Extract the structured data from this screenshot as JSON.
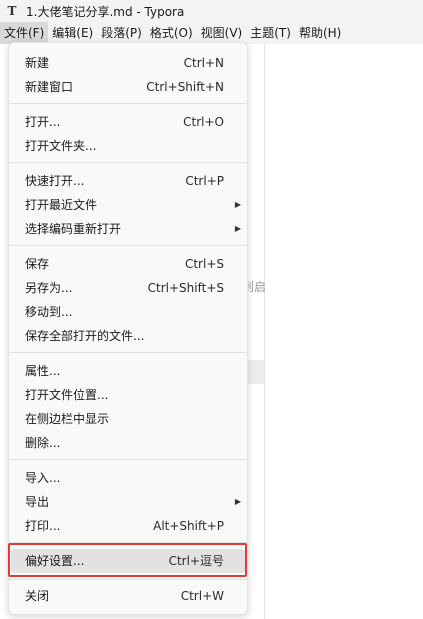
{
  "window": {
    "app_icon": "T",
    "title": "1.大佬笔记分享.md - Typora"
  },
  "menubar": [
    {
      "label": "文件(F)",
      "active": true
    },
    {
      "label": "编辑(E)"
    },
    {
      "label": "段落(P)"
    },
    {
      "label": "格式(O)"
    },
    {
      "label": "视图(V)"
    },
    {
      "label": "主题(T)"
    },
    {
      "label": "帮助(H)"
    }
  ],
  "background": {
    "partial_text": "到启"
  },
  "file_menu": {
    "items": [
      {
        "label": "新建",
        "shortcut": "Ctrl+N"
      },
      {
        "label": "新建窗口",
        "shortcut": "Ctrl+Shift+N"
      },
      {
        "label": "打开...",
        "shortcut": "Ctrl+O"
      },
      {
        "label": "打开文件夹...",
        "shortcut": ""
      },
      {
        "label": "快速打开...",
        "shortcut": "Ctrl+P"
      },
      {
        "label": "打开最近文件",
        "shortcut": "",
        "submenu": true
      },
      {
        "label": "选择编码重新打开",
        "shortcut": "",
        "submenu": true
      },
      {
        "label": "保存",
        "shortcut": "Ctrl+S"
      },
      {
        "label": "另存为...",
        "shortcut": "Ctrl+Shift+S"
      },
      {
        "label": "移动到...",
        "shortcut": ""
      },
      {
        "label": "保存全部打开的文件...",
        "shortcut": ""
      },
      {
        "label": "属性...",
        "shortcut": ""
      },
      {
        "label": "打开文件位置...",
        "shortcut": ""
      },
      {
        "label": "在侧边栏中显示",
        "shortcut": ""
      },
      {
        "label": "删除...",
        "shortcut": ""
      },
      {
        "label": "导入...",
        "shortcut": ""
      },
      {
        "label": "导出",
        "shortcut": "",
        "submenu": true
      },
      {
        "label": "打印...",
        "shortcut": "Alt+Shift+P"
      },
      {
        "label": "偏好设置...",
        "shortcut": "Ctrl+逗号",
        "highlighted": true
      },
      {
        "label": "关闭",
        "shortcut": "Ctrl+W"
      }
    ],
    "submenu_arrow": "▶"
  },
  "colors": {
    "highlight_outline": "#e03a3a",
    "menu_background": "#f9f9f9",
    "chrome_background": "#f3f3f3"
  }
}
